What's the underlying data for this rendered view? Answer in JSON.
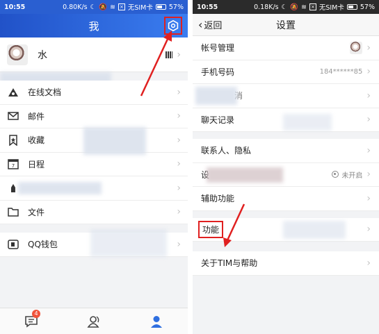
{
  "left": {
    "status": {
      "time": "10:55",
      "speed": "0.80K/s",
      "sim": "无SIM卡",
      "battery": "57%"
    },
    "header": {
      "title": "我"
    },
    "profile": {
      "name": "水"
    },
    "menu": [
      {
        "label": "在线文档",
        "icon": "cloud-doc-icon"
      },
      {
        "label": "邮件",
        "icon": "mail-icon"
      },
      {
        "label": "收藏",
        "icon": "bookmark-icon"
      },
      {
        "label": "日程",
        "icon": "calendar-icon"
      },
      {
        "label": "",
        "icon": "cloud-icon"
      },
      {
        "label": "文件",
        "icon": "folder-icon"
      }
    ],
    "wallet": {
      "label": "QQ钱包",
      "icon": "wallet-icon"
    },
    "tabbar": {
      "badge": "4"
    }
  },
  "right": {
    "status": {
      "time": "10:55",
      "speed": "0.18K/s",
      "sim": "无SIM卡",
      "battery": "57%"
    },
    "header": {
      "back": "返回",
      "title": "设置"
    },
    "rows": {
      "account": "帐号管理",
      "phone": "手机号码",
      "phone_value": "184******85",
      "msg": "消",
      "chat": "聊天记录",
      "contacts": "联系人、隐私",
      "settings_partial": "设",
      "settings_status": "未开启",
      "accessibility": "辅助功能",
      "feature": "功能",
      "about": "关于TIM与帮助"
    },
    "accent": "#e02020"
  }
}
